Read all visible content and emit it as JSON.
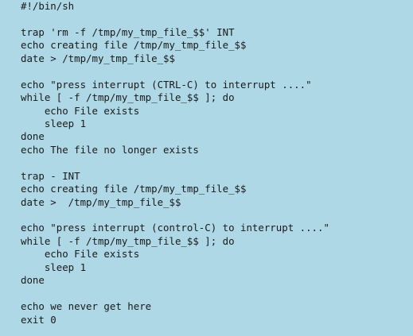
{
  "document": {
    "lines": [
      "#!/bin/sh",
      "",
      "trap 'rm -f /tmp/my_tmp_file_$$' INT",
      "echo creating file /tmp/my_tmp_file_$$",
      "date > /tmp/my_tmp_file_$$",
      "",
      "echo \"press interrupt (CTRL-C) to interrupt ....\"",
      "while [ -f /tmp/my_tmp_file_$$ ]; do",
      "    echo File exists",
      "    sleep 1",
      "done",
      "echo The file no longer exists",
      "",
      "trap - INT",
      "echo creating file /tmp/my_tmp_file_$$",
      "date >  /tmp/my_tmp_file_$$",
      "",
      "echo \"press interrupt (control-C) to interrupt ....\"",
      "while [ -f /tmp/my_tmp_file_$$ ]; do",
      "    echo File exists",
      "    sleep 1",
      "done",
      "",
      "echo we never get here",
      "exit 0"
    ]
  }
}
